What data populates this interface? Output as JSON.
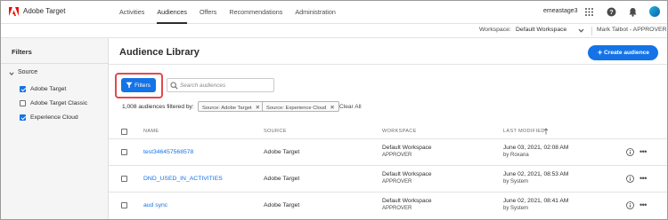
{
  "app": {
    "brand": "Adobe Target"
  },
  "nav": {
    "links": [
      "Activities",
      "Audiences",
      "Offers",
      "Recommendations",
      "Administration"
    ],
    "active": "Audiences",
    "user_id": "emeastage3"
  },
  "workspace_bar": {
    "label": "Workspace:",
    "value": "Default Workspace",
    "user": "Mark Talbot - APPROVER"
  },
  "sidebar": {
    "title": "Filters",
    "section": "Source",
    "options": [
      {
        "label": "Adobe Target",
        "checked": true
      },
      {
        "label": "Adobe Target Classic",
        "checked": false
      },
      {
        "label": "Experience Cloud",
        "checked": true
      }
    ]
  },
  "main": {
    "title": "Audience Library",
    "create_button": "Create audience",
    "filters_button": "Filters",
    "search_placeholder": "Search audiences",
    "filter_count": "1,008 audiences filtered by:",
    "tags": [
      "Source: Adobe Target",
      "Source: Experience Cloud"
    ],
    "clear_all": "Clear All"
  },
  "table": {
    "headers": {
      "name": "NAME",
      "source": "SOURCE",
      "workspace": "WORKSPACE",
      "modified": "LAST MODIFIED"
    },
    "rows": [
      {
        "name": "test346457568578",
        "source": "Adobe Target",
        "workspace": "Default Workspace",
        "role": "APPROVER",
        "date": "June 03, 2021, 02:08 AM",
        "by": "by Roxana"
      },
      {
        "name": "DND_USED_IN_ACTIVITIES",
        "source": "Adobe Target",
        "workspace": "Default Workspace",
        "role": "APPROVER",
        "date": "June 02, 2021, 08:53 AM",
        "by": "by System"
      },
      {
        "name": "aud sync",
        "source": "Adobe Target",
        "workspace": "Default Workspace",
        "role": "APPROVER",
        "date": "June 02, 2021, 08:41 AM",
        "by": "by System"
      }
    ]
  },
  "colors": {
    "accent": "#1473e6",
    "adobe_red": "#eb1000",
    "highlight": "#e34850"
  }
}
